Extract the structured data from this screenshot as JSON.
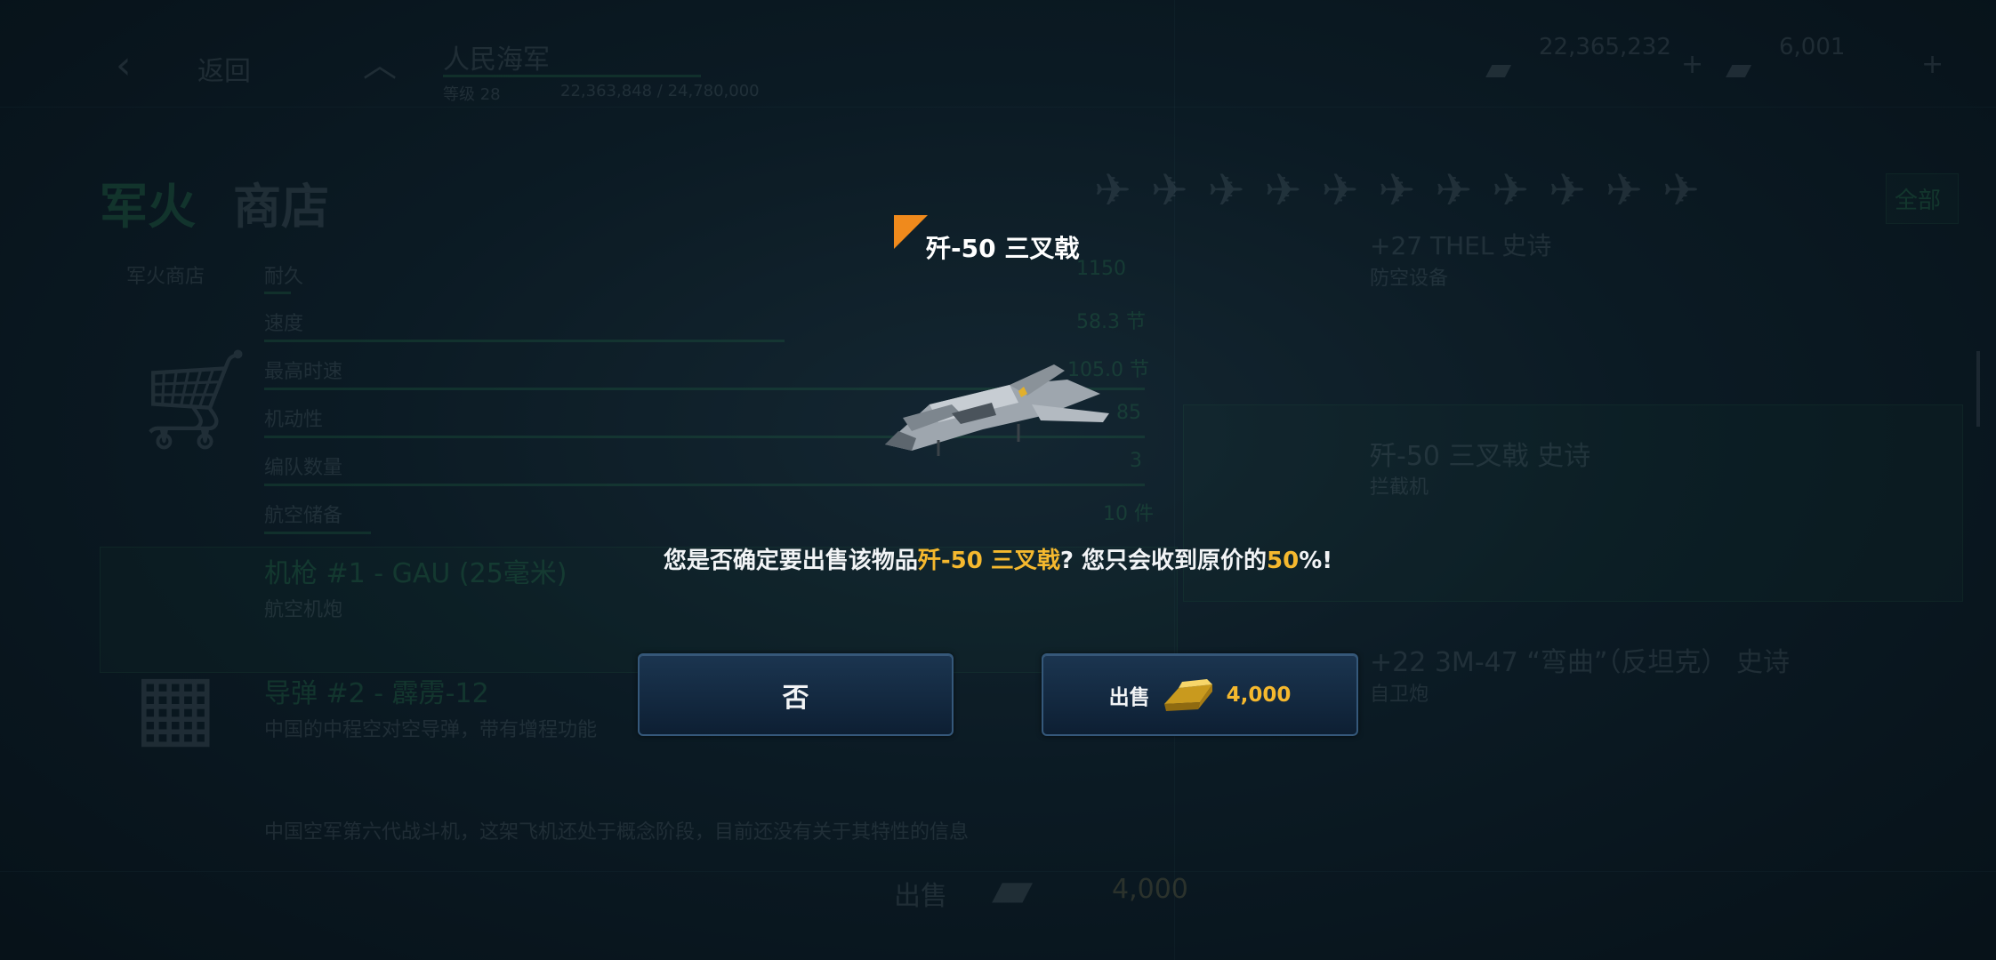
{
  "background": {
    "back_label": "返回",
    "faction_name": "人民海军",
    "level_label": "等级 28",
    "xp_text": "22,363,848 / 24,780,000",
    "currency_dollars": "22,365,232",
    "currency_gold": "6,001",
    "shop_title_a": "军火",
    "shop_title_b": "商店",
    "shop_tab": "军火商店",
    "stats": [
      "耐久",
      "速度",
      "最高时速",
      "机动性",
      "编队数量",
      "航空储备"
    ],
    "stat_values": [
      "1150",
      "58.3 节",
      "105.0 节",
      "85",
      "3",
      "10 件"
    ],
    "weapon_1": "机枪 #1 - GAU (25毫米)",
    "weapon_1_sub": "航空机炮",
    "weapon_2": "导弹 #2 - 霹雳-12",
    "weapon_2_sub": "中国的中程空对空导弹，带有增程功能",
    "description": "中国空军第六代战斗机，这架飞机还处于概念阶段，目前还没有关于其特性的信息",
    "right_item_1": "+27 THEL 史诗",
    "right_item_1_sub": "防空设备",
    "right_item_2": "歼-50 三叉戟 史诗",
    "right_item_2_sub": "拦截机",
    "right_item_3": "+22 3M-47 “弯曲”（反坦克） 史诗",
    "right_item_3_sub": "自卫炮",
    "all_label": "全部",
    "bottom_sell": "出售",
    "bottom_price": "4,000"
  },
  "dialog": {
    "title": "歼-50 三叉戟",
    "message_prefix": "您是否确定要出售该物品",
    "item_name": "歼-50 三叉戟",
    "message_middle": "? 您只会收到原价的",
    "percent": "50",
    "message_suffix": "%!",
    "no_label": "否",
    "sell_label": "出售",
    "sell_price": "4,000",
    "sell_currency_icon": "gold-bar-icon",
    "accent_color": "#f5b82e",
    "corner_color": "#f08a1c"
  }
}
